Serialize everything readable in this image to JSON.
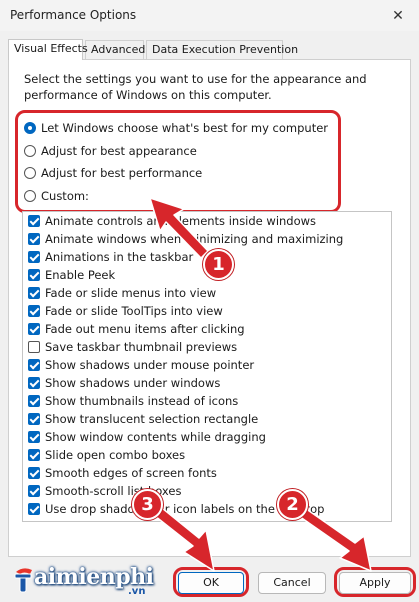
{
  "window": {
    "title": "Performance Options",
    "close_glyph": "✕"
  },
  "tabs": [
    {
      "label": "Visual Effects",
      "active": true
    },
    {
      "label": "Advanced",
      "active": false
    },
    {
      "label": "Data Execution Prevention",
      "active": false
    }
  ],
  "description": "Select the settings you want to use for the appearance and performance of Windows on this computer.",
  "radios": [
    {
      "label": "Let Windows choose what's best for my computer",
      "checked": true
    },
    {
      "label": "Adjust for best appearance",
      "checked": false
    },
    {
      "label": "Adjust for best performance",
      "checked": false
    },
    {
      "label": "Custom:",
      "checked": false
    }
  ],
  "options": [
    {
      "label": "Animate controls and elements inside windows",
      "checked": true
    },
    {
      "label": "Animate windows when minimizing and maximizing",
      "checked": true
    },
    {
      "label": "Animations in the taskbar",
      "checked": true
    },
    {
      "label": "Enable Peek",
      "checked": true
    },
    {
      "label": "Fade or slide menus into view",
      "checked": true
    },
    {
      "label": "Fade or slide ToolTips into view",
      "checked": true
    },
    {
      "label": "Fade out menu items after clicking",
      "checked": true
    },
    {
      "label": "Save taskbar thumbnail previews",
      "checked": false
    },
    {
      "label": "Show shadows under mouse pointer",
      "checked": true
    },
    {
      "label": "Show shadows under windows",
      "checked": true
    },
    {
      "label": "Show thumbnails instead of icons",
      "checked": true
    },
    {
      "label": "Show translucent selection rectangle",
      "checked": true
    },
    {
      "label": "Show window contents while dragging",
      "checked": true
    },
    {
      "label": "Slide open combo boxes",
      "checked": true
    },
    {
      "label": "Smooth edges of screen fonts",
      "checked": true
    },
    {
      "label": "Smooth-scroll list boxes",
      "checked": true
    },
    {
      "label": "Use drop shadows for icon labels on the desktop",
      "checked": true
    }
  ],
  "buttons": {
    "ok": "OK",
    "cancel": "Cancel",
    "apply": "Apply"
  },
  "annotations": {
    "step1": "1",
    "step2": "2",
    "step3": "3"
  },
  "watermark": {
    "brand": "aimienphi",
    "domain": ".vn"
  },
  "colors": {
    "accent": "#0067c0",
    "annotation_red": "#d7262b"
  }
}
